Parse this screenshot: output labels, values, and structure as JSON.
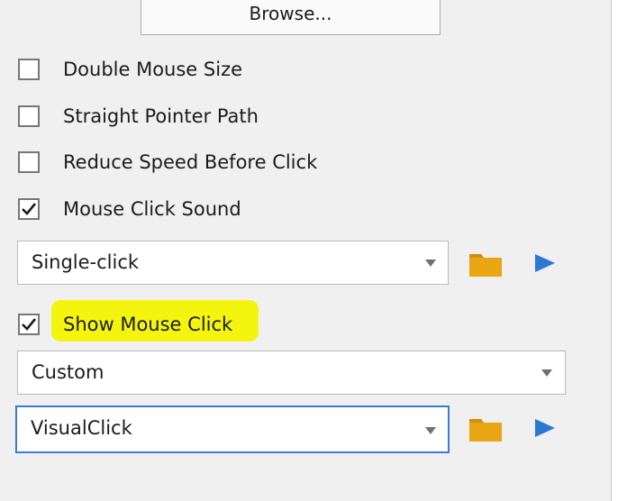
{
  "browse": {
    "label": "Browse..."
  },
  "options": {
    "double_mouse_size": {
      "label": "Double Mouse Size",
      "checked": false
    },
    "straight_pointer_path": {
      "label": "Straight Pointer Path",
      "checked": false
    },
    "reduce_speed": {
      "label": "Reduce Speed Before Click",
      "checked": false
    },
    "mouse_click_sound": {
      "label": "Mouse Click Sound",
      "checked": true
    },
    "show_mouse_click": {
      "label": "Show Mouse Click",
      "checked": true
    }
  },
  "sound_select": {
    "value": "Single-click"
  },
  "click_style_select": {
    "value": "Custom"
  },
  "visual_select": {
    "value": "VisualClick"
  },
  "icons": {
    "folder": "folder-icon",
    "play": "play-icon",
    "dropdown": "chevron-down-icon",
    "check": "checkmark-icon"
  },
  "colors": {
    "highlight": "#f4f50f",
    "folder": "#e8a615",
    "play": "#2b78d4",
    "focus_border": "#3a7bd5"
  }
}
